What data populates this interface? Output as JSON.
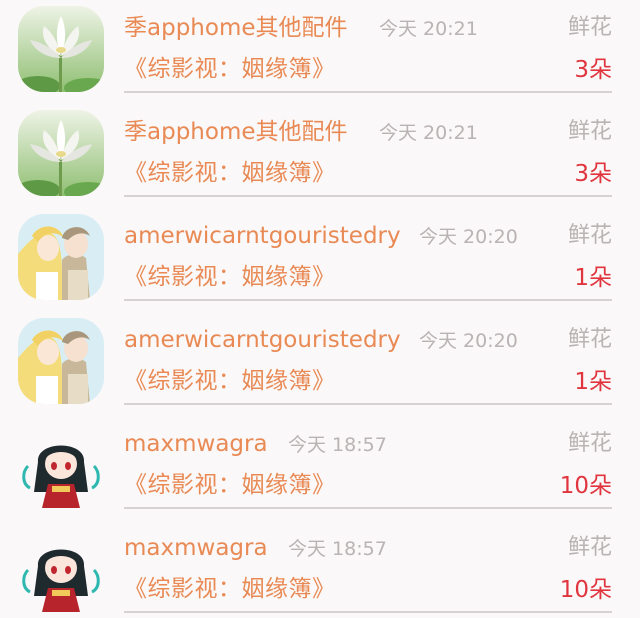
{
  "feed": {
    "items": [
      {
        "username": "季apphome其他配件",
        "time": "今天 20:21",
        "gift": "鲜花",
        "book": "《综影视：姻缘簿》",
        "count": "3朵",
        "avatar": "lotus-avatar"
      },
      {
        "username": "季apphome其他配件",
        "time": "今天 20:21",
        "gift": "鲜花",
        "book": "《综影视：姻缘簿》",
        "count": "3朵",
        "avatar": "lotus-avatar"
      },
      {
        "username": "amerwicarntgouristedry",
        "time": "今天 20:20",
        "gift": "鲜花",
        "book": "《综影视：姻缘簿》",
        "count": "1朵",
        "avatar": "anime-couple-avatar"
      },
      {
        "username": "amerwicarntgouristedry",
        "time": "今天 20:20",
        "gift": "鲜花",
        "book": "《综影视：姻缘簿》",
        "count": "1朵",
        "avatar": "anime-couple-avatar"
      },
      {
        "username": "maxmwagra",
        "time": "今天 18:57",
        "gift": "鲜花",
        "book": "《综影视：姻缘簿》",
        "count": "10朵",
        "avatar": "chibi-girl-avatar"
      },
      {
        "username": "maxmwagra",
        "time": "今天 18:57",
        "gift": "鲜花",
        "book": "《综影视：姻缘簿》",
        "count": "10朵",
        "avatar": "chibi-girl-avatar"
      }
    ]
  }
}
